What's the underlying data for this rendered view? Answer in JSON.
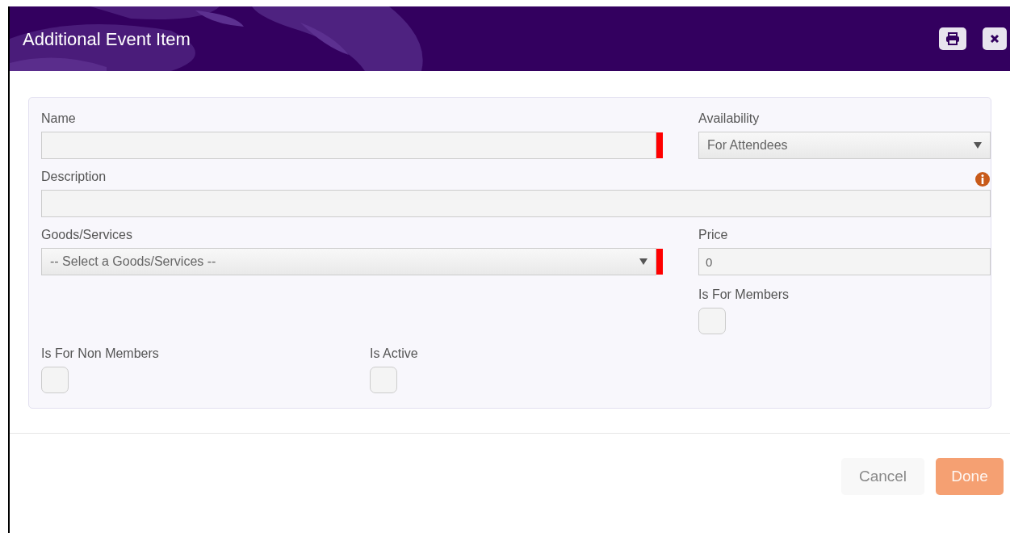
{
  "dialog": {
    "title": "Additional Event Item"
  },
  "name_field": {
    "label": "Name",
    "required": true
  },
  "availability": {
    "label": "Availability",
    "value": "For Attendees"
  },
  "description": {
    "label": "Description",
    "info": true
  },
  "goods_services": {
    "label": "Goods/Services",
    "value": "-- Select a Goods/Services --",
    "required": true
  },
  "price": {
    "label": "Price",
    "value": "0"
  },
  "is_for_members": {
    "label": "Is For Members",
    "checked": false
  },
  "is_for_non_members": {
    "label": "Is For Non Members",
    "checked": false
  },
  "is_active": {
    "label": "Is Active",
    "checked": false
  },
  "buttons": [
    {
      "label": "Cancel",
      "kind": "secondary",
      "disabled": false
    },
    {
      "label": "Done",
      "kind": "primary",
      "disabled": true
    }
  ]
}
